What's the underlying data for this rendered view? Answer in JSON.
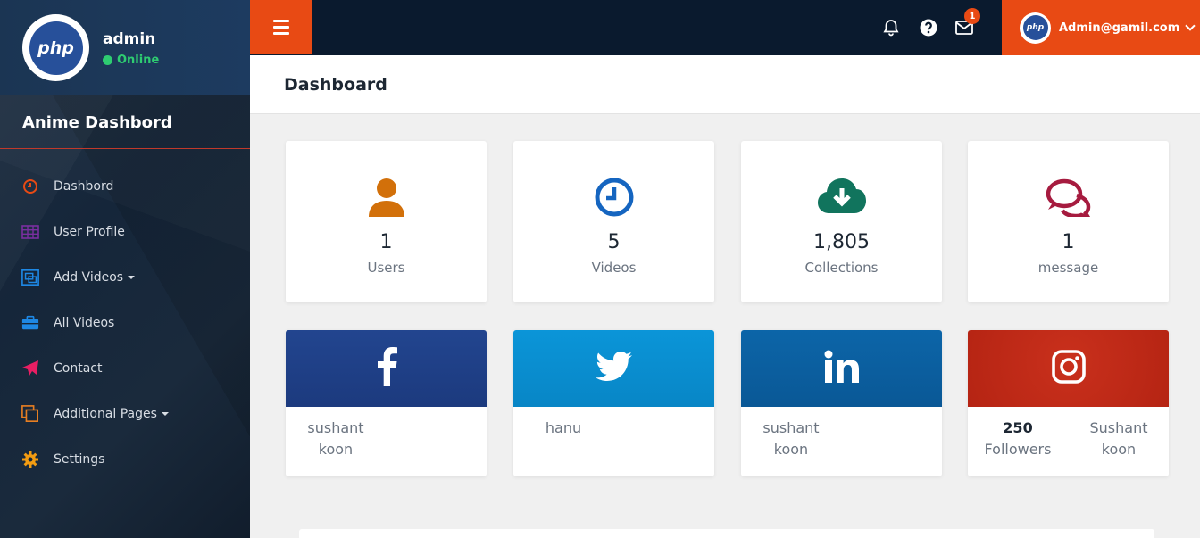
{
  "sidebar": {
    "profile": {
      "name": "admin",
      "status": "Online",
      "avatar_text": "php"
    },
    "brand": "Anime Dashbord",
    "nav": [
      {
        "label": "Dashbord",
        "icon": "clock-icon",
        "color": "#e84a14"
      },
      {
        "label": "User Profile",
        "icon": "grid-icon",
        "color": "#7b2fa0"
      },
      {
        "label": "Add Videos",
        "icon": "screens-icon",
        "color": "#1e88e5",
        "dropdown": true
      },
      {
        "label": "All Videos",
        "icon": "briefcase-icon",
        "color": "#1e88e5"
      },
      {
        "label": "Contact",
        "icon": "paper-plane-icon",
        "color": "#e91e63"
      },
      {
        "label": "Additional Pages",
        "icon": "copy-icon",
        "color": "#e67e22",
        "dropdown": true
      },
      {
        "label": "Settings",
        "icon": "gear-icon",
        "color": "#f39c12"
      }
    ]
  },
  "topbar": {
    "notification_badge": "1",
    "user_email": "Admin@gamil.com",
    "avatar_text": "php",
    "accent_color": "#e84a14"
  },
  "page": {
    "title": "Dashboard"
  },
  "stats": [
    {
      "value": "1",
      "label": "Users",
      "icon": "user-icon",
      "color": "#d2700a"
    },
    {
      "value": "5",
      "label": "Videos",
      "icon": "clock-icon",
      "color": "#1565c0"
    },
    {
      "value": "1,805",
      "label": "Collections",
      "icon": "cloud-download-icon",
      "color": "#11745d"
    },
    {
      "value": "1",
      "label": "message",
      "icon": "comments-icon",
      "color": "#a61b3f"
    }
  ],
  "social": [
    {
      "network": "facebook",
      "icon": "facebook-icon",
      "color": "#1f3f8b",
      "line1": "sushant",
      "line2": "koon"
    },
    {
      "network": "twitter",
      "icon": "twitter-icon",
      "color": "#0a8ed0",
      "line1": "hanu"
    },
    {
      "network": "linkedin",
      "icon": "linkedin-icon",
      "color": "#0a5d9e",
      "line1": "sushant",
      "line2": "koon"
    },
    {
      "network": "instagram",
      "icon": "instagram-icon",
      "color": "#c02a18",
      "followers_count": "250",
      "followers_label": "Followers",
      "line1": "Sushant",
      "line2": "koon"
    }
  ]
}
